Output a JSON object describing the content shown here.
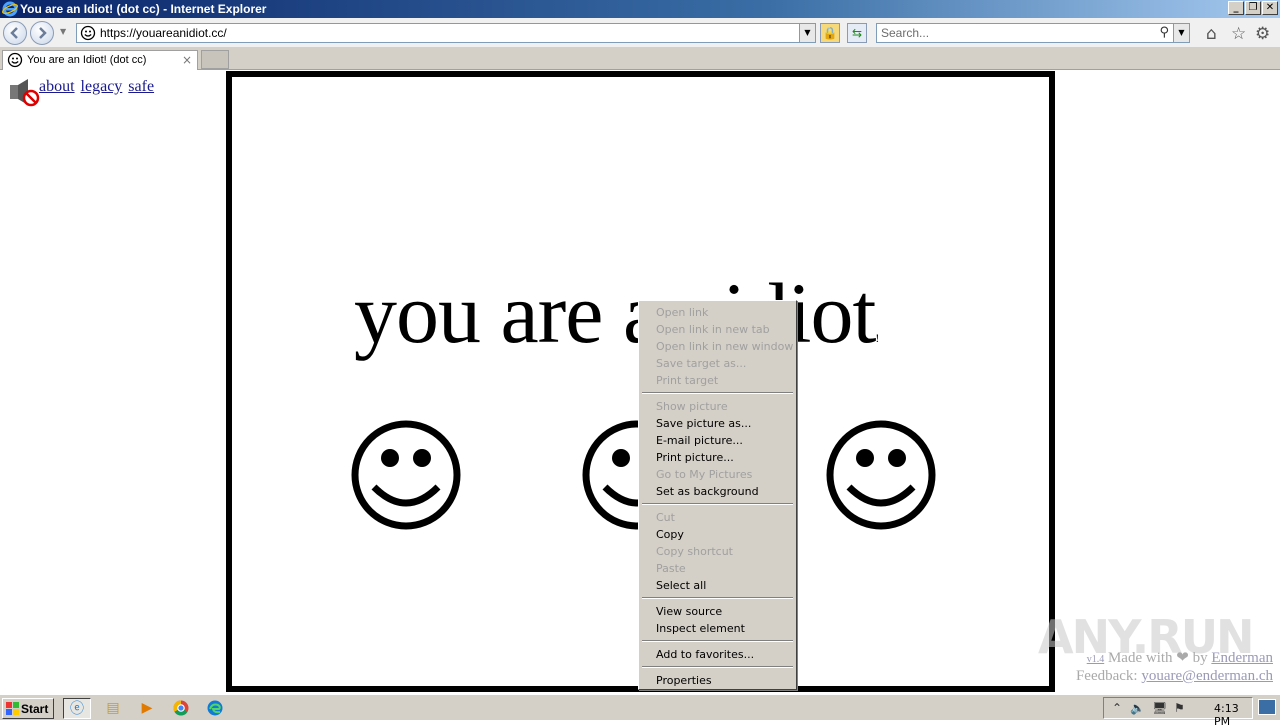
{
  "window": {
    "title": "You are an Idiot! (dot cc) - Internet Explorer",
    "minimize": "_",
    "restore": "❐",
    "close": "✕"
  },
  "navbar": {
    "url": "https://youareanidiot.cc/",
    "search_placeholder": "Search..."
  },
  "tab": {
    "label": "You are an Idiot! (dot cc)",
    "close": "×"
  },
  "page": {
    "links": [
      "about",
      "legacy",
      "safe"
    ],
    "headline": "you are an idiot",
    "headline_suffix": "!",
    "version": "v1.4",
    "made_with": "Made with",
    "heart": "❤",
    "by": "by",
    "author": "Enderman",
    "feedback_label": "Feedback:",
    "feedback_email": "youare@enderman.ch"
  },
  "watermark": "ANY.RUN",
  "context_menu": {
    "groups": [
      [
        {
          "label": "Open link",
          "enabled": false
        },
        {
          "label": "Open link in new tab",
          "enabled": false
        },
        {
          "label": "Open link in new window",
          "enabled": false
        },
        {
          "label": "Save target as...",
          "enabled": false
        },
        {
          "label": "Print target",
          "enabled": false
        }
      ],
      [
        {
          "label": "Show picture",
          "enabled": false
        },
        {
          "label": "Save picture as...",
          "enabled": true
        },
        {
          "label": "E-mail picture...",
          "enabled": true
        },
        {
          "label": "Print picture...",
          "enabled": true
        },
        {
          "label": "Go to My Pictures",
          "enabled": false
        },
        {
          "label": "Set as background",
          "enabled": true
        }
      ],
      [
        {
          "label": "Cut",
          "enabled": false
        },
        {
          "label": "Copy",
          "enabled": true
        },
        {
          "label": "Copy shortcut",
          "enabled": false
        },
        {
          "label": "Paste",
          "enabled": false
        },
        {
          "label": "Select all",
          "enabled": true
        }
      ],
      [
        {
          "label": "View source",
          "enabled": true
        },
        {
          "label": "Inspect element",
          "enabled": true
        }
      ],
      [
        {
          "label": "Add to favorites...",
          "enabled": true
        }
      ],
      [
        {
          "label": "Properties",
          "enabled": true
        }
      ]
    ]
  },
  "taskbar": {
    "start": "Start",
    "clock": "4:13 PM"
  },
  "colors": {
    "title_gradient_start": "#0a246a",
    "menu_bg": "#d4d0c8",
    "link": "#1a1a8e"
  }
}
